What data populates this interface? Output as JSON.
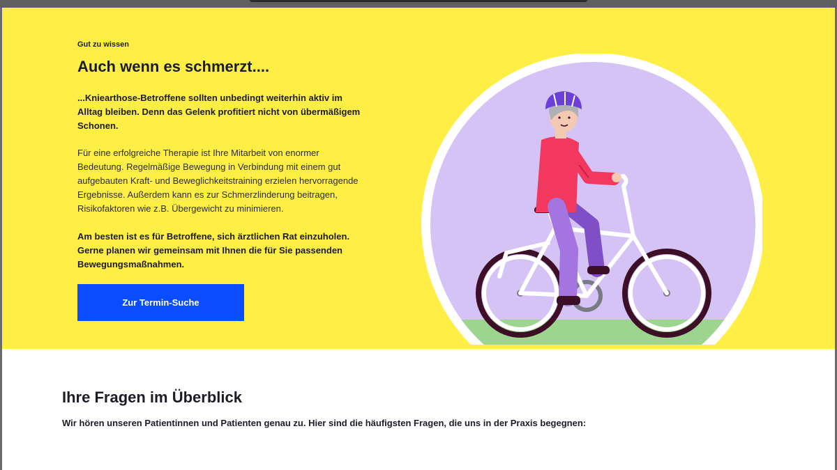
{
  "hero": {
    "eyebrow": "Gut zu wissen",
    "title": "Auch wenn es schmerzt....",
    "lead": "...Kniearthose-Betroffene sollten unbedingt weiterhin aktiv im Alltag bleiben. Denn das Gelenk profitiert nicht von übermäßigem Schonen.",
    "body": "Für eine erfolgreiche Therapie ist Ihre Mitarbeit von enormer Bedeutung. Regelmäßige Bewegung in Verbindung mit einem gut aufgebauten Kraft- und Beweglichkeitstraining erzielen hervorragende Ergebnisse. Außerdem kann es zur Schmerzlinderung beitragen, Risikofaktoren wie z.B. Übergewicht zu minimieren.",
    "closing": "Am besten ist es für Betroffene, sich ärztlichen Rat einzuholen. Gerne planen wir gemeinsam mit Ihnen die für Sie passenden Bewegungsmaßnahmen.",
    "cta_label": "Zur Termin-Suche",
    "illustration_icon": "cyclist-illustration"
  },
  "faq": {
    "title": "Ihre Fragen im Überblick",
    "subtitle": "Wir hören unseren Patientinnen und Patienten genau zu. Hier sind die häufigsten Fragen, die uns in der Praxis begegnen:"
  },
  "colors": {
    "hero_bg": "#ffee45",
    "cta_bg": "#0a4dff",
    "circle_bg": "#d6c3f5",
    "shirt": "#f2385f",
    "pants": "#9a6ad6",
    "helmet": "#6b3fd8",
    "grass": "#9dd58f"
  }
}
